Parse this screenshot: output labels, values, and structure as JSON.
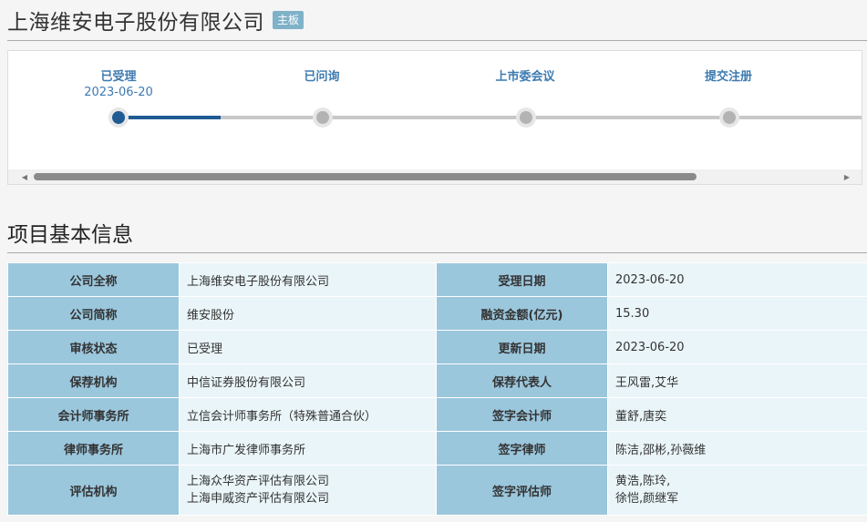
{
  "header": {
    "company_name": "上海维安电子股份有限公司",
    "board_badge": "主板"
  },
  "progress": {
    "steps": [
      {
        "label": "已受理",
        "date": "2023-06-20",
        "active": true
      },
      {
        "label": "已问询",
        "date": "",
        "active": false
      },
      {
        "label": "上市委会议",
        "date": "",
        "active": false
      },
      {
        "label": "提交注册",
        "date": "",
        "active": false
      }
    ]
  },
  "section": {
    "title": "项目基本信息"
  },
  "info_table": {
    "rows": [
      {
        "k1": "公司全称",
        "v1": "上海维安电子股份有限公司",
        "k2": "受理日期",
        "v2": "2023-06-20"
      },
      {
        "k1": "公司简称",
        "v1": "维安股份",
        "k2": "融资金额(亿元)",
        "v2": "15.30"
      },
      {
        "k1": "审核状态",
        "v1": "已受理",
        "k2": "更新日期",
        "v2": "2023-06-20"
      },
      {
        "k1": "保荐机构",
        "v1": "中信证券股份有限公司",
        "k2": "保荐代表人",
        "v2": "王风雷,艾华"
      },
      {
        "k1": "会计师事务所",
        "v1": "立信会计师事务所（特殊普通合伙）",
        "k2": "签字会计师",
        "v2": "董舒,唐奕"
      },
      {
        "k1": "律师事务所",
        "v1": "上海市广发律师事务所",
        "k2": "签字律师",
        "v2": "陈洁,邵彬,孙薇维"
      },
      {
        "k1": "评估机构",
        "v1a": "上海众华资产评估有限公司",
        "v1b": "上海申威资产评估有限公司",
        "k2": "签字评估师",
        "v2a": "黄浩,陈玲,",
        "v2b": "徐恺,颜继军"
      }
    ]
  }
}
